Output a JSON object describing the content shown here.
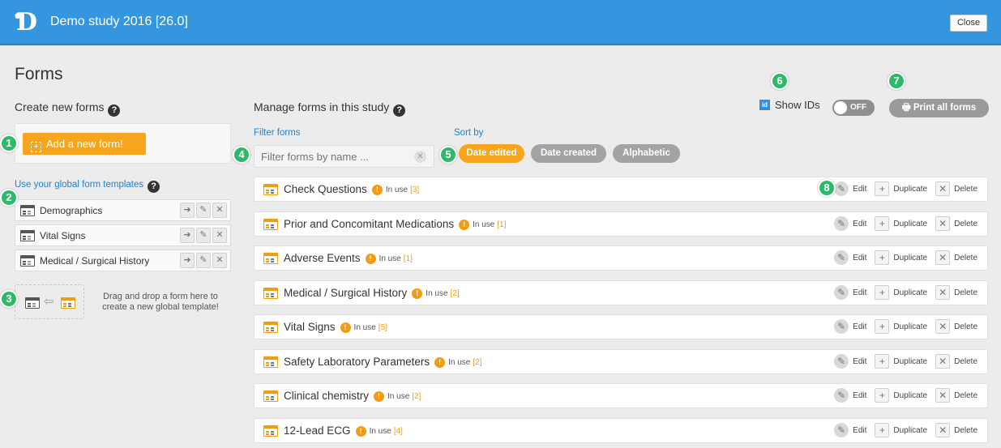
{
  "app": {
    "logo_letter": "D",
    "title": "Demo study 2016 [26.0]",
    "close_label": "Close"
  },
  "page": {
    "title": "Forms"
  },
  "left": {
    "heading": "Create new forms",
    "add_button": "Add a new form!",
    "templates_link": "Use your global form templates",
    "templates": [
      {
        "name": "Demographics"
      },
      {
        "name": "Vital Signs"
      },
      {
        "name": "Medical / Surgical History"
      }
    ],
    "drop_text": "Drag and drop a form here to create a new global template!"
  },
  "manage": {
    "heading": "Manage forms in this study",
    "filter_label": "Filter forms",
    "filter_placeholder": "Filter forms by name ...",
    "sort_label": "Sort by",
    "sort_options": [
      {
        "label": "Date edited",
        "active": true
      },
      {
        "label": "Date created",
        "active": false
      },
      {
        "label": "Alphabetic",
        "active": false
      }
    ],
    "show_ids_label": "Show IDs",
    "id_icon": "id",
    "toggle_state": "OFF",
    "print_label": "Print all forms",
    "in_use_label": "In use",
    "actions": {
      "edit": "Edit",
      "duplicate": "Duplicate",
      "delete": "Delete"
    },
    "forms": [
      {
        "name": "Check Questions",
        "count": "[3]"
      },
      {
        "name": "Prior and Concomitant Medications",
        "count": "[1]"
      },
      {
        "name": "Adverse Events",
        "count": "[1]"
      },
      {
        "name": "Medical / Surgical History",
        "count": "[2]"
      },
      {
        "name": "Vital Signs",
        "count": "[5]"
      },
      {
        "name": "Safety Laboratory Parameters",
        "count": "[2]"
      },
      {
        "name": "Clinical chemistry",
        "count": "[2]"
      },
      {
        "name": "12-Lead ECG",
        "count": "[4]"
      }
    ]
  },
  "callouts": [
    "1",
    "2",
    "3",
    "4",
    "5",
    "6",
    "7",
    "8"
  ],
  "colors": {
    "header": "#3596e0",
    "accent": "#f7a51c",
    "link": "#2380cc",
    "badge": "#2eb86a",
    "pill_inactive": "#a3a3a3"
  }
}
